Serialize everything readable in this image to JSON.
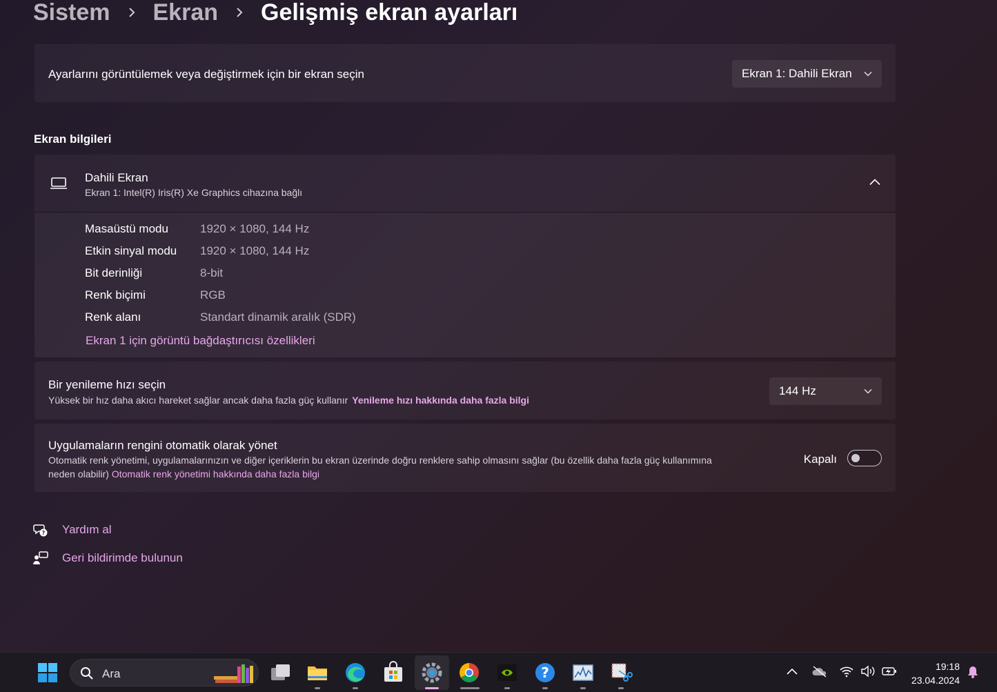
{
  "breadcrumb": {
    "item1": "Sistem",
    "item2": "Ekran",
    "current": "Gelişmiş ekran ayarları"
  },
  "selector": {
    "label": "Ayarlarını görüntülemek veya değiştirmek için bir ekran seçin",
    "value": "Ekran 1: Dahili Ekran"
  },
  "section_title": "Ekran bilgileri",
  "display_info": {
    "title": "Dahili Ekran",
    "subtitle": "Ekran 1: Intel(R) Iris(R) Xe Graphics cihazına bağlı",
    "properties": [
      {
        "label": "Masaüstü modu",
        "value": "1920 × 1080, 144 Hz"
      },
      {
        "label": "Etkin sinyal modu",
        "value": "1920 × 1080, 144 Hz"
      },
      {
        "label": "Bit derinliği",
        "value": "8-bit"
      },
      {
        "label": "Renk biçimi",
        "value": "RGB"
      },
      {
        "label": "Renk alanı",
        "value": "Standart dinamik aralık (SDR)"
      }
    ],
    "adapter_link": "Ekran 1 için görüntü bağdaştırıcısı özellikleri"
  },
  "refresh": {
    "title": "Bir yenileme hızı seçin",
    "description": "Yüksek bir hız daha akıcı hareket sağlar ancak daha fazla güç kullanır",
    "link": "Yenileme hızı hakkında daha fazla bilgi",
    "value": "144 Hz"
  },
  "color_mgmt": {
    "title": "Uygulamaların rengini otomatik olarak yönet",
    "desc_line1": "Otomatik renk yönetimi, uygulamalarınızın ve diğer içeriklerin bu ekran üzerinde doğru renklere sahip olmasını sağlar (bu özellik daha fazla güç kullanımına",
    "desc_line2": "neden olabilir)",
    "link": "Otomatik renk yönetimi hakkında daha fazla bilgi",
    "toggle_label": "Kapalı",
    "toggle_on": false
  },
  "help": {
    "get_help": "Yardım al",
    "feedback": "Geri bildirimde bulunun"
  },
  "taskbar": {
    "search_placeholder": "Ara",
    "time": "19:18",
    "date": "23.04.2024"
  },
  "colors": {
    "accent_link": "#e6a8e8",
    "taskbar_bg": "#1e1a22"
  }
}
